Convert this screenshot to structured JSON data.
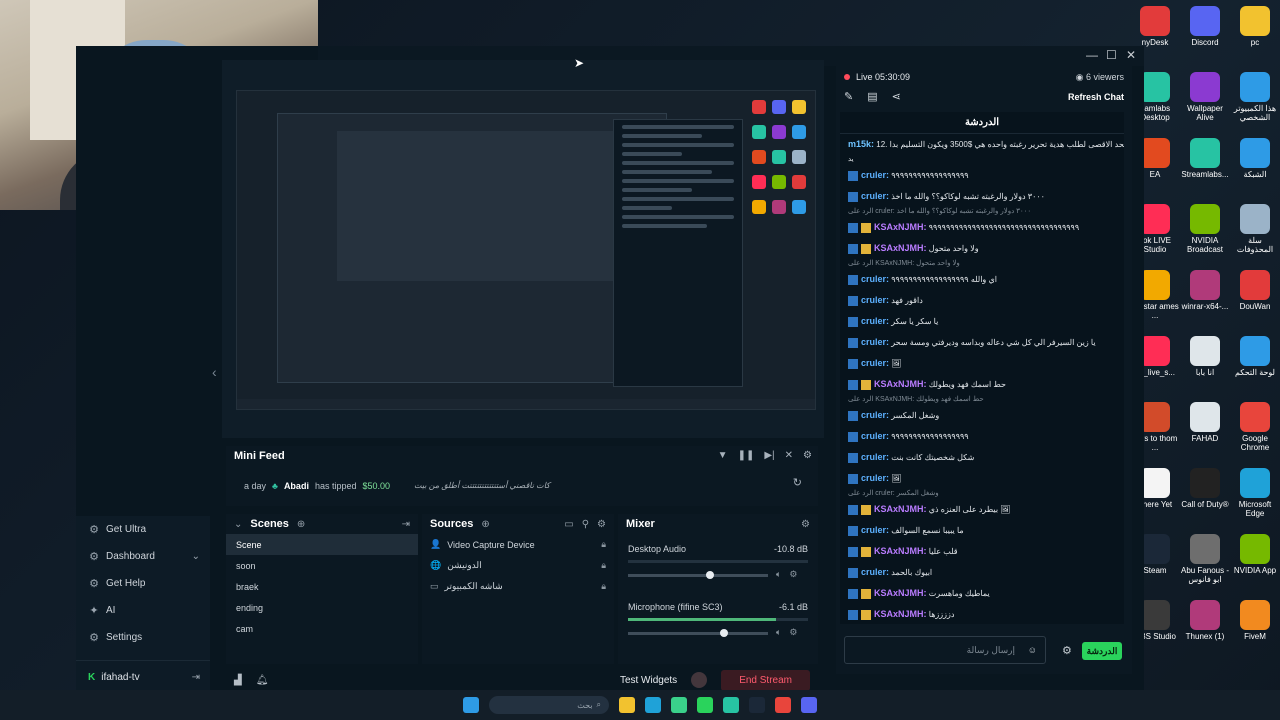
{
  "chat": {
    "live_label": "Live 05:30:09",
    "viewers": "6 viewers",
    "refresh_label": "Refresh Chat",
    "header": "الدردشة",
    "first_msg_user": "m15k:",
    "first_msg_text": "الحد الاقصى لطلب هدية تحرير رغبته واحده هي $3500 ويكون التسليم بدا .12",
    "first_msg_cont": "يد",
    "messages": [
      {
        "user": "cruler:",
        "cls": "c1",
        "crown": false,
        "text": "٩٩٩٩٩٩٩٩٩٩٩٩٩٩٩٩٩٩",
        "reply": ""
      },
      {
        "user": "cruler:",
        "cls": "c1",
        "crown": false,
        "text": "٣٠٠٠ دولار والرغبته تشبه لوكاكو؟؟ والله ما اخذ",
        "reply": ""
      },
      {
        "user": "KSAxNJMH:",
        "cls": "c2",
        "crown": true,
        "text": "٩٩٩٩٩٩٩٩٩٩٩٩٩٩٩٩٩٩٩٩٩٩٩٩٩٩٩٩٩٩٩٩٩٩٩",
        "reply": "الرد على cruler: ٣٠٠٠ دولار والرغبته تشبه لوكاكو؟؟ والله ما اخذ"
      },
      {
        "user": "KSAxNJMH:",
        "cls": "c2",
        "crown": true,
        "text": "ولا واحد متحول",
        "reply": ""
      },
      {
        "user": "cruler:",
        "cls": "c1",
        "crown": false,
        "text": "اي والله ٩٩٩٩٩٩٩٩٩٩٩٩٩٩٩٩٩٩",
        "reply": "الرد على KSAxNJMH: ولا واحد متحول"
      },
      {
        "user": "cruler:",
        "cls": "c1",
        "crown": false,
        "text": "داقور فهد",
        "reply": ""
      },
      {
        "user": "cruler:",
        "cls": "c1",
        "crown": false,
        "text": "يا سكر يا سكر",
        "reply": ""
      },
      {
        "user": "cruler:",
        "cls": "c1",
        "crown": false,
        "text": "يا زين السيرفر الي كل شي دعاله وبداسه وديرفتي ومسة سحر",
        "reply": ""
      },
      {
        "user": "cruler:",
        "cls": "c1",
        "crown": false,
        "text": "🖼",
        "reply": ""
      },
      {
        "user": "KSAxNJMH:",
        "cls": "c2",
        "crown": true,
        "text": "حط اسمك فهد ويطولك",
        "reply": ""
      },
      {
        "user": "cruler:",
        "cls": "c1",
        "crown": false,
        "text": "وشغل المكسر",
        "reply": "الرد على KSAxNJMH: حط اسمك فهد ويطولك"
      },
      {
        "user": "cruler:",
        "cls": "c1",
        "crown": false,
        "text": "٩٩٩٩٩٩٩٩٩٩٩٩٩٩٩٩٩٩",
        "reply": ""
      },
      {
        "user": "cruler:",
        "cls": "c1",
        "crown": false,
        "text": "شكل شخصيتك كانت بنت",
        "reply": ""
      },
      {
        "user": "cruler:",
        "cls": "c1",
        "crown": false,
        "text": "🖼",
        "reply": ""
      },
      {
        "user": "KSAxNJMH:",
        "cls": "c2",
        "crown": true,
        "text": "بيطرد على العنزه ذي 🖼",
        "reply": "الرد على cruler: وشغل المكسر"
      },
      {
        "user": "cruler:",
        "cls": "c1",
        "crown": false,
        "text": "ما يبيبا نسمع السوالف",
        "reply": ""
      },
      {
        "user": "KSAxNJMH:",
        "cls": "c2",
        "crown": true,
        "text": "قلب عليا",
        "reply": ""
      },
      {
        "user": "cruler:",
        "cls": "c1",
        "crown": false,
        "text": "ابيوك بالحمد",
        "reply": ""
      },
      {
        "user": "KSAxNJMH:",
        "cls": "c2",
        "crown": true,
        "text": "يماطيك وماهسرت",
        "reply": ""
      },
      {
        "user": "KSAxNJMH:",
        "cls": "c2",
        "crown": true,
        "text": "دززززها",
        "reply": ""
      }
    ],
    "input_placeholder": "إرسال رسالة",
    "send_label": "الدردشة"
  },
  "sidebar": {
    "items": [
      {
        "label": "Get Ultra",
        "icon": "ultra-icon",
        "glyph": "⚙"
      },
      {
        "label": "Dashboard",
        "icon": "dashboard-icon",
        "glyph": "⚙"
      },
      {
        "label": "Get Help",
        "icon": "help-icon",
        "glyph": "⚙"
      },
      {
        "label": "AI",
        "icon": "ai-icon",
        "glyph": "✦"
      },
      {
        "label": "Settings",
        "icon": "gear-icon",
        "glyph": "⚙"
      }
    ],
    "user": "ifahad-tv"
  },
  "minifeed": {
    "title": "Mini Feed",
    "time": "a day",
    "name": "Abadi",
    "action": "has tipped",
    "amount": "$50.00",
    "message": "كات ناقصني أستتتتتتتتتتتتت أطلق من بيت"
  },
  "scenes": {
    "title": "Scenes",
    "items": [
      "Scene",
      "soon",
      "braek",
      "ending",
      "cam"
    ]
  },
  "sources": {
    "title": "Sources",
    "items": [
      {
        "label": "Video Capture Device",
        "glyph": "👤"
      },
      {
        "label": "الدونيشن",
        "glyph": "🌐"
      },
      {
        "label": "شاشه الكمبيوتر",
        "glyph": "▭"
      }
    ]
  },
  "mixer": {
    "title": "Mixer",
    "channels": [
      {
        "name": "Desktop Audio",
        "db": "-10.8 dB",
        "level": 0.0,
        "volume": 0.59
      },
      {
        "name": "Microphone (fifine SC3)",
        "db": "-6.1 dB",
        "level": 0.82,
        "volume": 0.7
      }
    ]
  },
  "bottombar": {
    "test_widgets": "Test Widgets",
    "end_stream": "End Stream"
  },
  "desktop_icons": [
    {
      "label": "nyDesk",
      "color": "#e23b3b"
    },
    {
      "label": "Discord",
      "color": "#5865f2"
    },
    {
      "label": "pc",
      "color": "#f2c22f"
    },
    {
      "label": "eamlabs Desktop",
      "color": "#27c3a3"
    },
    {
      "label": "Wallpaper Alive",
      "color": "#8b3ad1"
    },
    {
      "label": "هذا الكمبيوتر الشخصي",
      "color": "#2e9be6"
    },
    {
      "label": "EA",
      "color": "#e24a1f"
    },
    {
      "label": "Streamlabs...",
      "color": "#27c3a3"
    },
    {
      "label": "الشبكة",
      "color": "#2e9be6"
    },
    {
      "label": "Tok LIVE Studio",
      "color": "#ff2d55"
    },
    {
      "label": "NVIDIA Broadcast",
      "color": "#76b900"
    },
    {
      "label": "سلة المحذوفات",
      "color": "#9bb3c8"
    },
    {
      "label": "ockstar ames ...",
      "color": "#f2a900"
    },
    {
      "label": "winrar-x64-...",
      "color": "#b03a7a"
    },
    {
      "label": "DouWan",
      "color": "#e23b3b"
    },
    {
      "label": "ok_live_s...",
      "color": "#ff2d55"
    },
    {
      "label": "انا بابا",
      "color": "#dfe6ea"
    },
    {
      "label": "لوحة التحكم",
      "color": "#2e9be6"
    },
    {
      "label": "ears to thom ...",
      "color": "#d24b2a"
    },
    {
      "label": "FAHAD",
      "color": "#dfe6ea"
    },
    {
      "label": "Google Chrome",
      "color": "#e8453c"
    },
    {
      "label": "There Yet",
      "color": "#f4f4f4"
    },
    {
      "label": "Call of Duty®",
      "color": "#222222"
    },
    {
      "label": "Microsoft Edge",
      "color": "#1fa2d8"
    },
    {
      "label": "Steam",
      "color": "#1b2838"
    },
    {
      "label": "Abu Fanous - ابو فانوس",
      "color": "#6e6e6e"
    },
    {
      "label": "NVIDIA App",
      "color": "#76b900"
    },
    {
      "label": "OBS Studio",
      "color": "#3a3a3a"
    },
    {
      "label": "Thunex (1)",
      "color": "#b03a7a"
    },
    {
      "label": "FiveM",
      "color": "#f28a1f"
    }
  ],
  "taskbar": {
    "search_placeholder": "بحث"
  }
}
